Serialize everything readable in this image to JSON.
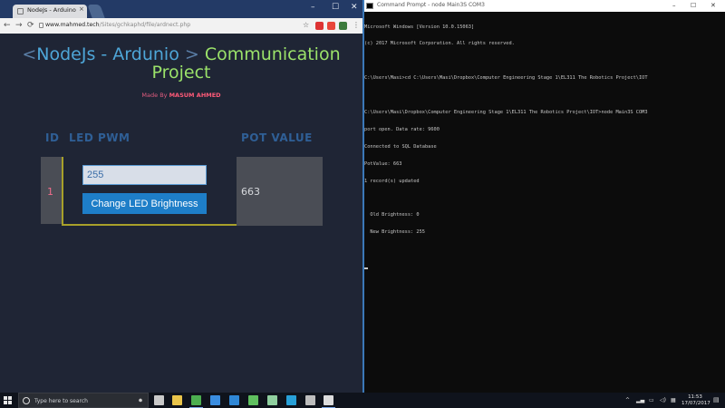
{
  "browser": {
    "tab_title": "NodeJs - Arduino Comm",
    "tab_close": "×",
    "window_minimize": "–",
    "window_maximize": "☐",
    "window_close": "✕",
    "nav_back": "←",
    "nav_forward": "→",
    "nav_reload": "⟳",
    "url_host": "www.mahmed.tech",
    "url_path": "/Sites/gchkaphd/file/ardnect.php",
    "bookmark_star": "☆"
  },
  "page": {
    "title_lt": "<",
    "title_main": "NodeJs - Ardunio",
    "title_gt": ">",
    "title_sub1": "Communication",
    "title_sub2": "Project",
    "credit_prefix": "Made By",
    "credit_name": "MASUM AHMED",
    "col_id": "ID",
    "col_pwm": "LED PWM",
    "col_pot": "POT VALUE",
    "row_id": "1",
    "pwm_value": "255",
    "button_label": "Change LED Brightness",
    "pot_value": "663"
  },
  "cmd": {
    "title": "Command Prompt - node Main3S COM3",
    "minimize": "–",
    "maximize": "☐",
    "close": "✕",
    "lines": [
      "Microsoft Windows [Version 10.0.15063]",
      "(c) 2017 Microsoft Corporation. All rights reserved.",
      "",
      "C:\\Users\\Masi>cd C:\\Users\\Masi\\Dropbox\\Computer Engineering Stage 1\\EL311 The Robotics Project\\IOT",
      "",
      "C:\\Users\\Masi\\Dropbox\\Computer Engineering Stage 1\\EL311 The Robotics Project\\IOT>node Main3S COM3",
      "port open. Data rate: 9600",
      "Connected to SQL Database",
      "PotValue: 663",
      "1 record(s) updated",
      "",
      "  Old Brightness: 0",
      "  New Brightness: 255",
      ""
    ]
  },
  "taskbar": {
    "search_placeholder": "Type here to search",
    "mic": "🎤",
    "time": "11:53",
    "date": "17/07/2017",
    "notifications": "💬",
    "tray_up": "^",
    "tray_network": "📶",
    "tray_volume": "🔊",
    "icons": [
      {
        "name": "task-view-icon",
        "color": "#c9c9c9"
      },
      {
        "name": "file-explorer-icon",
        "color": "#e9c44a"
      },
      {
        "name": "chrome-icon",
        "color": "#4caf50"
      },
      {
        "name": "store-icon",
        "color": "#3a8de0"
      },
      {
        "name": "app-icon-blue",
        "color": "#2f87d6"
      },
      {
        "name": "app-icon-green",
        "color": "#5fbf5f"
      },
      {
        "name": "notepad-icon",
        "color": "#8fcf9f"
      },
      {
        "name": "app-icon-cyan",
        "color": "#28a0d8"
      },
      {
        "name": "app-icon-grey",
        "color": "#bdbdbd"
      },
      {
        "name": "command-prompt-icon",
        "color": "#dcdcdc"
      }
    ]
  }
}
